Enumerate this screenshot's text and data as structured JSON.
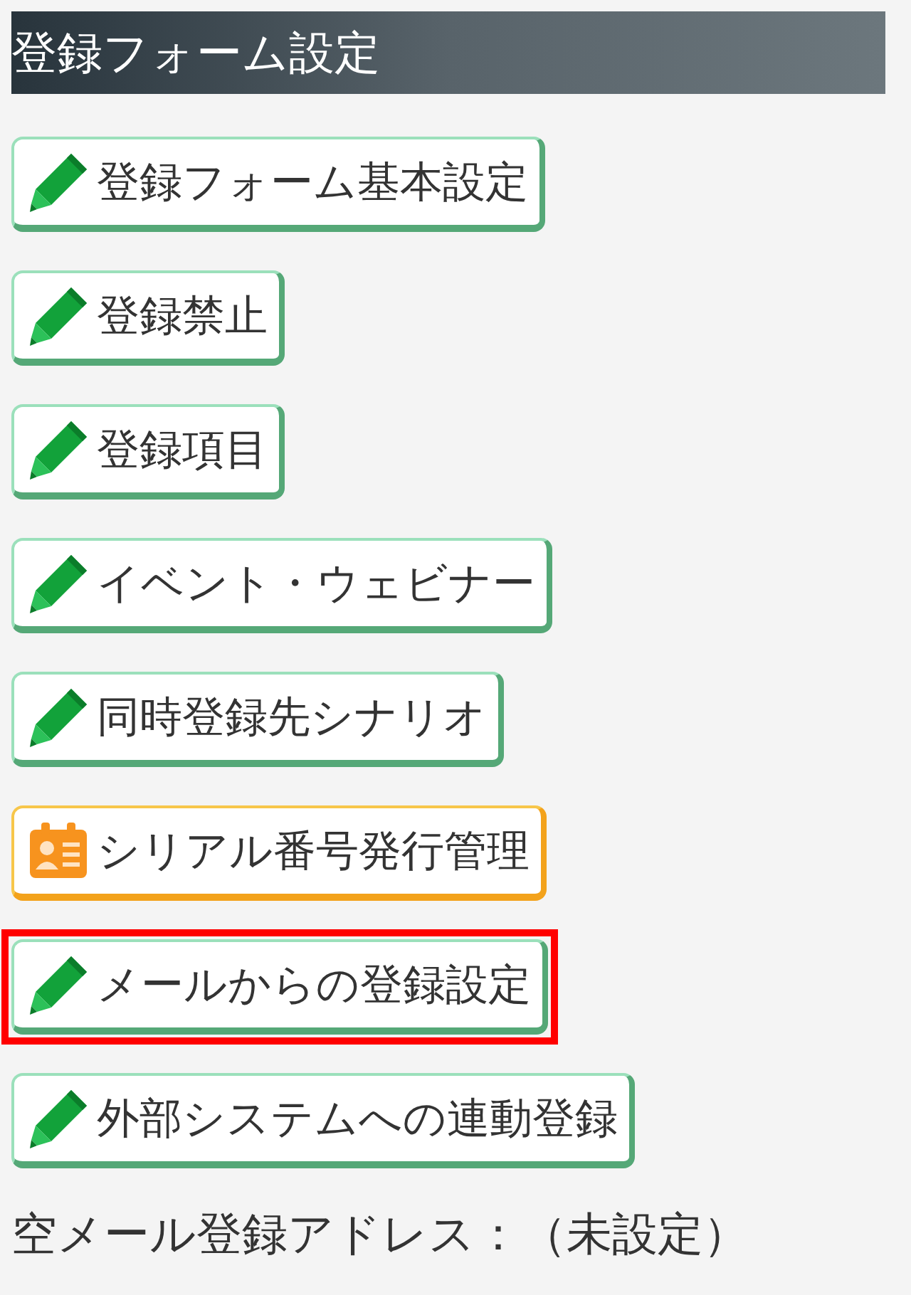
{
  "section": {
    "title": "登録フォーム設定"
  },
  "buttons": [
    {
      "label": "登録フォーム基本設定",
      "kind": "edit",
      "highlighted": false
    },
    {
      "label": "登録禁止",
      "kind": "edit",
      "highlighted": false
    },
    {
      "label": "登録項目",
      "kind": "edit",
      "highlighted": false
    },
    {
      "label": "イベント・ウェビナー",
      "kind": "edit",
      "highlighted": false
    },
    {
      "label": "同時登録先シナリオ",
      "kind": "edit",
      "highlighted": false
    },
    {
      "label": "シリアル番号発行管理",
      "kind": "serial",
      "highlighted": false
    },
    {
      "label": "メールからの登録設定",
      "kind": "edit",
      "highlighted": true
    },
    {
      "label": "外部システムへの連動登録",
      "kind": "edit",
      "highlighted": false
    }
  ],
  "footer": {
    "label": "空メール登録アドレス：",
    "value": "（未設定）"
  }
}
